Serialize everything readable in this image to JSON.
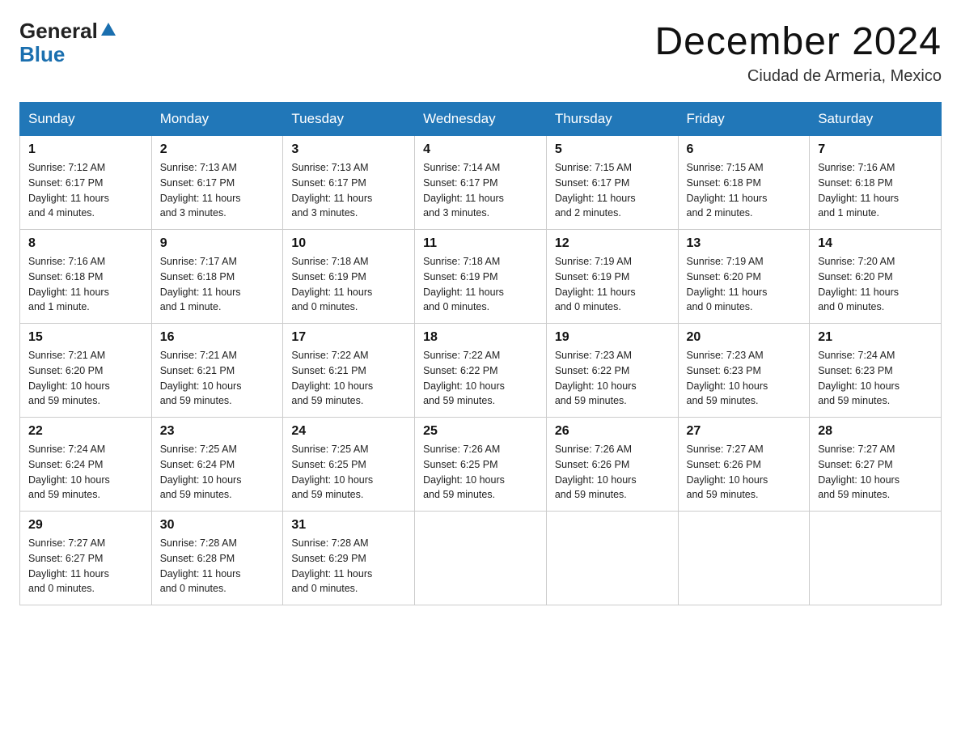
{
  "header": {
    "logo_line1": "General",
    "logo_line2": "Blue",
    "title": "December 2024",
    "subtitle": "Ciudad de Armeria, Mexico"
  },
  "columns": [
    "Sunday",
    "Monday",
    "Tuesday",
    "Wednesday",
    "Thursday",
    "Friday",
    "Saturday"
  ],
  "weeks": [
    [
      {
        "day": "1",
        "info": "Sunrise: 7:12 AM\nSunset: 6:17 PM\nDaylight: 11 hours\nand 4 minutes."
      },
      {
        "day": "2",
        "info": "Sunrise: 7:13 AM\nSunset: 6:17 PM\nDaylight: 11 hours\nand 3 minutes."
      },
      {
        "day": "3",
        "info": "Sunrise: 7:13 AM\nSunset: 6:17 PM\nDaylight: 11 hours\nand 3 minutes."
      },
      {
        "day": "4",
        "info": "Sunrise: 7:14 AM\nSunset: 6:17 PM\nDaylight: 11 hours\nand 3 minutes."
      },
      {
        "day": "5",
        "info": "Sunrise: 7:15 AM\nSunset: 6:17 PM\nDaylight: 11 hours\nand 2 minutes."
      },
      {
        "day": "6",
        "info": "Sunrise: 7:15 AM\nSunset: 6:18 PM\nDaylight: 11 hours\nand 2 minutes."
      },
      {
        "day": "7",
        "info": "Sunrise: 7:16 AM\nSunset: 6:18 PM\nDaylight: 11 hours\nand 1 minute."
      }
    ],
    [
      {
        "day": "8",
        "info": "Sunrise: 7:16 AM\nSunset: 6:18 PM\nDaylight: 11 hours\nand 1 minute."
      },
      {
        "day": "9",
        "info": "Sunrise: 7:17 AM\nSunset: 6:18 PM\nDaylight: 11 hours\nand 1 minute."
      },
      {
        "day": "10",
        "info": "Sunrise: 7:18 AM\nSunset: 6:19 PM\nDaylight: 11 hours\nand 0 minutes."
      },
      {
        "day": "11",
        "info": "Sunrise: 7:18 AM\nSunset: 6:19 PM\nDaylight: 11 hours\nand 0 minutes."
      },
      {
        "day": "12",
        "info": "Sunrise: 7:19 AM\nSunset: 6:19 PM\nDaylight: 11 hours\nand 0 minutes."
      },
      {
        "day": "13",
        "info": "Sunrise: 7:19 AM\nSunset: 6:20 PM\nDaylight: 11 hours\nand 0 minutes."
      },
      {
        "day": "14",
        "info": "Sunrise: 7:20 AM\nSunset: 6:20 PM\nDaylight: 11 hours\nand 0 minutes."
      }
    ],
    [
      {
        "day": "15",
        "info": "Sunrise: 7:21 AM\nSunset: 6:20 PM\nDaylight: 10 hours\nand 59 minutes."
      },
      {
        "day": "16",
        "info": "Sunrise: 7:21 AM\nSunset: 6:21 PM\nDaylight: 10 hours\nand 59 minutes."
      },
      {
        "day": "17",
        "info": "Sunrise: 7:22 AM\nSunset: 6:21 PM\nDaylight: 10 hours\nand 59 minutes."
      },
      {
        "day": "18",
        "info": "Sunrise: 7:22 AM\nSunset: 6:22 PM\nDaylight: 10 hours\nand 59 minutes."
      },
      {
        "day": "19",
        "info": "Sunrise: 7:23 AM\nSunset: 6:22 PM\nDaylight: 10 hours\nand 59 minutes."
      },
      {
        "day": "20",
        "info": "Sunrise: 7:23 AM\nSunset: 6:23 PM\nDaylight: 10 hours\nand 59 minutes."
      },
      {
        "day": "21",
        "info": "Sunrise: 7:24 AM\nSunset: 6:23 PM\nDaylight: 10 hours\nand 59 minutes."
      }
    ],
    [
      {
        "day": "22",
        "info": "Sunrise: 7:24 AM\nSunset: 6:24 PM\nDaylight: 10 hours\nand 59 minutes."
      },
      {
        "day": "23",
        "info": "Sunrise: 7:25 AM\nSunset: 6:24 PM\nDaylight: 10 hours\nand 59 minutes."
      },
      {
        "day": "24",
        "info": "Sunrise: 7:25 AM\nSunset: 6:25 PM\nDaylight: 10 hours\nand 59 minutes."
      },
      {
        "day": "25",
        "info": "Sunrise: 7:26 AM\nSunset: 6:25 PM\nDaylight: 10 hours\nand 59 minutes."
      },
      {
        "day": "26",
        "info": "Sunrise: 7:26 AM\nSunset: 6:26 PM\nDaylight: 10 hours\nand 59 minutes."
      },
      {
        "day": "27",
        "info": "Sunrise: 7:27 AM\nSunset: 6:26 PM\nDaylight: 10 hours\nand 59 minutes."
      },
      {
        "day": "28",
        "info": "Sunrise: 7:27 AM\nSunset: 6:27 PM\nDaylight: 10 hours\nand 59 minutes."
      }
    ],
    [
      {
        "day": "29",
        "info": "Sunrise: 7:27 AM\nSunset: 6:27 PM\nDaylight: 11 hours\nand 0 minutes."
      },
      {
        "day": "30",
        "info": "Sunrise: 7:28 AM\nSunset: 6:28 PM\nDaylight: 11 hours\nand 0 minutes."
      },
      {
        "day": "31",
        "info": "Sunrise: 7:28 AM\nSunset: 6:29 PM\nDaylight: 11 hours\nand 0 minutes."
      },
      {
        "day": "",
        "info": ""
      },
      {
        "day": "",
        "info": ""
      },
      {
        "day": "",
        "info": ""
      },
      {
        "day": "",
        "info": ""
      }
    ]
  ]
}
